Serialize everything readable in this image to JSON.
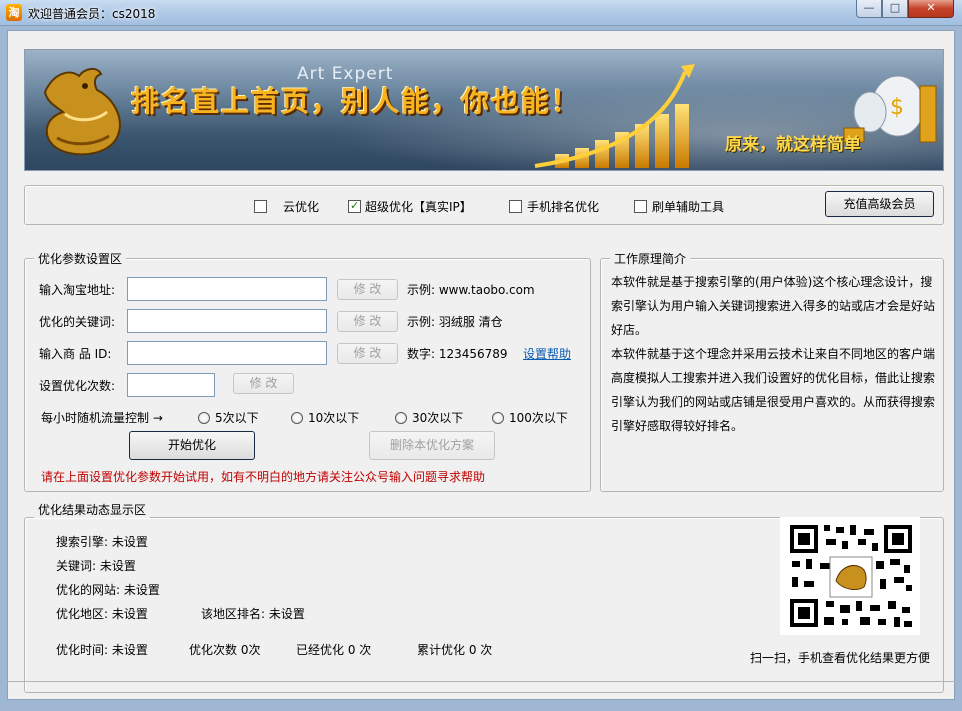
{
  "window": {
    "icon_char": "淘",
    "title": "欢迎普通会员：cs2018",
    "min_symbol": "—",
    "max_symbol": "□",
    "close_symbol": "✕"
  },
  "banner": {
    "brand": "Art Expert",
    "slogan": "排名直上首页，别人能，你也能！",
    "subtitle": "原来，就这样简单"
  },
  "options": {
    "items": [
      {
        "label": "云优化",
        "checked": false
      },
      {
        "label": "超级优化【真实IP】",
        "checked": true
      },
      {
        "label": "手机排名优化",
        "checked": false
      },
      {
        "label": "刷单辅助工具",
        "checked": false
      }
    ],
    "recharge_button": "充值高级会员"
  },
  "params": {
    "legend": "优化参数设置区",
    "url_label": "输入淘宝地址:",
    "url_value": "",
    "url_modify": "修 改",
    "url_example": "示例: www.taobo.com",
    "keyword_label": "优化的关键词:",
    "keyword_value": "",
    "keyword_modify": "修 改",
    "keyword_example": "示例: 羽绒服 清仓",
    "product_label": "输入商 品 ID:",
    "product_value": "",
    "product_modify": "修 改",
    "product_example": "数字: 123456789",
    "help_link": "设置帮助",
    "count_label": "设置优化次数:",
    "count_value": "",
    "count_modify": "修 改",
    "flow_label": "每小时随机流量控制 →",
    "flow_options": [
      "5次以下",
      "10次以下",
      "30次以下",
      "100次以下"
    ],
    "start_button": "开始优化",
    "delete_button": "删除本优化方案",
    "warning": "请在上面设置优化参数开始试用，如有不明白的地方请关注公众号输入问题寻求帮助"
  },
  "intro": {
    "legend": "工作原理简介",
    "paragraphs": [
      "本软件就是基于搜索引擎的(用户体验)这个核心理念设计，搜索引擎认为用户输入关键词搜索进入得多的站或店才会是好站好店。",
      "本软件就基于这个理念并采用云技术让来自不同地区的客户端高度模拟人工搜索并进入我们设置好的优化目标，借此让搜索引擎认为我们的网站或店铺是很受用户喜欢的。从而获得搜索引擎好感取得较好排名。"
    ]
  },
  "results": {
    "legend": "优化结果动态显示区",
    "engine": "搜索引擎: 未设置",
    "keyword": "关键词: 未设置",
    "site": "优化的网站: 未设置",
    "region": "优化地区: 未设置",
    "region_rank": "该地区排名: 未设置",
    "time": "优化时间: 未设置",
    "times": "优化次数 0次",
    "done": "已经优化 0 次",
    "total": "累计优化 0 次",
    "qr_caption": "扫一扫，手机查看优化结果更方便"
  }
}
